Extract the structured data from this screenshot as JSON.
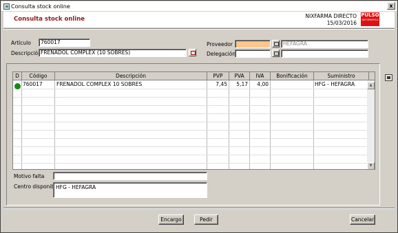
{
  "window": {
    "title": "Consulta stock online",
    "close": "x"
  },
  "header": {
    "title": "Consulta stock online",
    "company": "NIXFARMA DIRECTO",
    "date": "15/03/2016",
    "logo": "PULSO",
    "logo_sub": "INFORMATICA"
  },
  "form": {
    "articulo_label": "Artículo",
    "articulo_value": "760017",
    "descripcion_label": "Descripción",
    "descripcion_value": "FRENADOL COMPLEX (10 SOBRES)",
    "proveedor_label": "Proveedor",
    "proveedor_code": "",
    "proveedor_name": "HEFAGRA",
    "delegacion_label": "Delegación",
    "delegacion_code": "",
    "delegacion_name": ""
  },
  "table": {
    "columns": [
      "D",
      "Código",
      "Descripción",
      "PVP",
      "PVA",
      "IVA",
      "Bonificación",
      "Suministro"
    ],
    "rows": [
      {
        "codigo": "760017",
        "descripcion": "FRENADOL COMPLEX 10 SOBRES",
        "pvp": "7,45",
        "pva": "5,17",
        "iva": "4,00",
        "bonificacion": "",
        "suministro": "HFG - HEFAGRA"
      }
    ]
  },
  "motivo_label": "Motivo falta",
  "motivo_value": "",
  "centro_label": "Centro disponible",
  "centro_value": "HFG - HEFAGRA",
  "buttons": {
    "encargo": "Encargo",
    "pedir": "Pedir",
    "cancelar": "Cancelar"
  },
  "colors": {
    "title_red": "#8b1a1a",
    "logo_red": "#e01010",
    "status_green": "#148a14",
    "proveedor_highlight": "#ffc58a"
  }
}
